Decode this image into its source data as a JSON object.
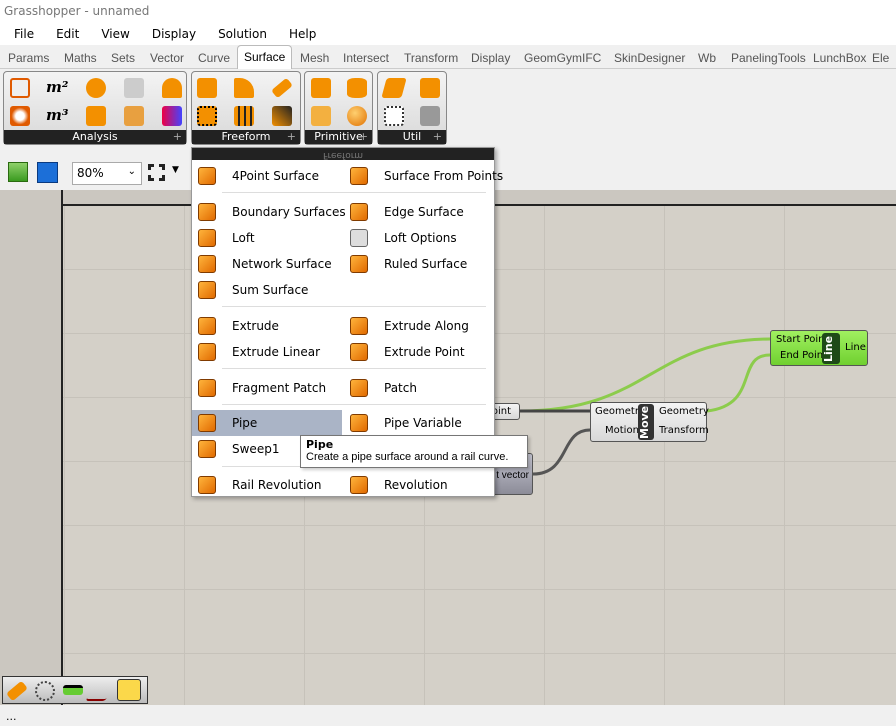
{
  "title": "Grasshopper - unnamed",
  "menubar": [
    "File",
    "Edit",
    "View",
    "Display",
    "Solution",
    "Help"
  ],
  "tabs": [
    "Params",
    "Maths",
    "Sets",
    "Vector",
    "Curve",
    "Surface",
    "Mesh",
    "Intersect",
    "Transform",
    "Display",
    "GeomGymIFC",
    "SkinDesigner",
    "Wb",
    "PanelingTools",
    "LunchBox",
    "Ele"
  ],
  "active_tab": "Surface",
  "panels": {
    "analysis": "Analysis",
    "analysis_icons": [
      "m²",
      "m³"
    ],
    "freeform": "Freeform",
    "primitive": "Primitive",
    "util": "Util"
  },
  "toolbar": {
    "zoom": "80%"
  },
  "menu": {
    "header": "Freeform",
    "items": [
      {
        "label": "4Point Surface"
      },
      {
        "label": "Surface From Points"
      },
      {
        "label": "Boundary Surfaces"
      },
      {
        "label": "Edge Surface"
      },
      {
        "label": "Loft"
      },
      {
        "label": "Loft Options"
      },
      {
        "label": "Network Surface"
      },
      {
        "label": "Ruled Surface"
      },
      {
        "label": "Sum Surface"
      },
      {
        "label": "Extrude"
      },
      {
        "label": "Extrude Along"
      },
      {
        "label": "Extrude Linear"
      },
      {
        "label": "Extrude Point"
      },
      {
        "label": "Fragment Patch"
      },
      {
        "label": "Patch"
      },
      {
        "label": "Pipe"
      },
      {
        "label": "Pipe Variable"
      },
      {
        "label": "Sweep1"
      },
      {
        "label": "Rail Revolution"
      },
      {
        "label": "Revolution"
      }
    ],
    "highlighted": "Pipe"
  },
  "tooltip": {
    "title": "Pipe",
    "text": "Create a pipe surface around a rail curve."
  },
  "nodes": {
    "point": {
      "output": "oint"
    },
    "vector": {
      "output": "t vector"
    },
    "move": {
      "name": "Move",
      "inputs": [
        "Geometry",
        "Motion"
      ],
      "outputs": [
        "Geometry",
        "Transform"
      ]
    },
    "line": {
      "name": "Line",
      "inputs": [
        "Start Point",
        "End Point"
      ],
      "outputs": [
        "Line"
      ]
    }
  },
  "status": "...",
  "colors": {
    "wire_selected": "#8ccc4c",
    "wire": "#555555",
    "line_node": "#88dd44",
    "accent": "#f08c00"
  }
}
